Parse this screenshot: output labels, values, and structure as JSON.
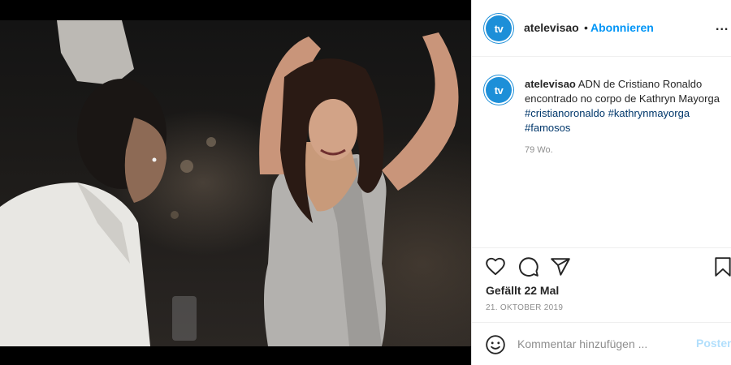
{
  "post": {
    "author": {
      "username": "atelevisao",
      "avatar_text": "tv",
      "avatar_color": "#1d8fd8"
    },
    "header": {
      "separator": "•",
      "follow_label": "Abonnieren",
      "more_label": "..."
    },
    "caption": {
      "username": "atelevisao",
      "text": "ADN de Cristiano Ronaldo encontrado no corpo de Kathryn Mayorga",
      "hashtags": [
        "#cristianoronaldo",
        "#kathrynmayorga",
        "#famosos"
      ],
      "age": "79 Wo."
    },
    "actions": {
      "like_icon": "heart-icon",
      "comment_icon": "comment-icon",
      "share_icon": "paper-plane-icon",
      "save_icon": "bookmark-icon"
    },
    "likes_label": "Gefällt 22 Mal",
    "date_label": "21. OKTOBER 2019",
    "comment": {
      "emoji_icon": "smiley-icon",
      "placeholder": "Kommentar hinzufügen ...",
      "post_label": "Posten"
    }
  },
  "colors": {
    "link_blue": "#0095f6",
    "hashtag_blue": "#00376b",
    "muted_gray": "#8e8e8e",
    "post_disabled": "#b2dffc"
  }
}
